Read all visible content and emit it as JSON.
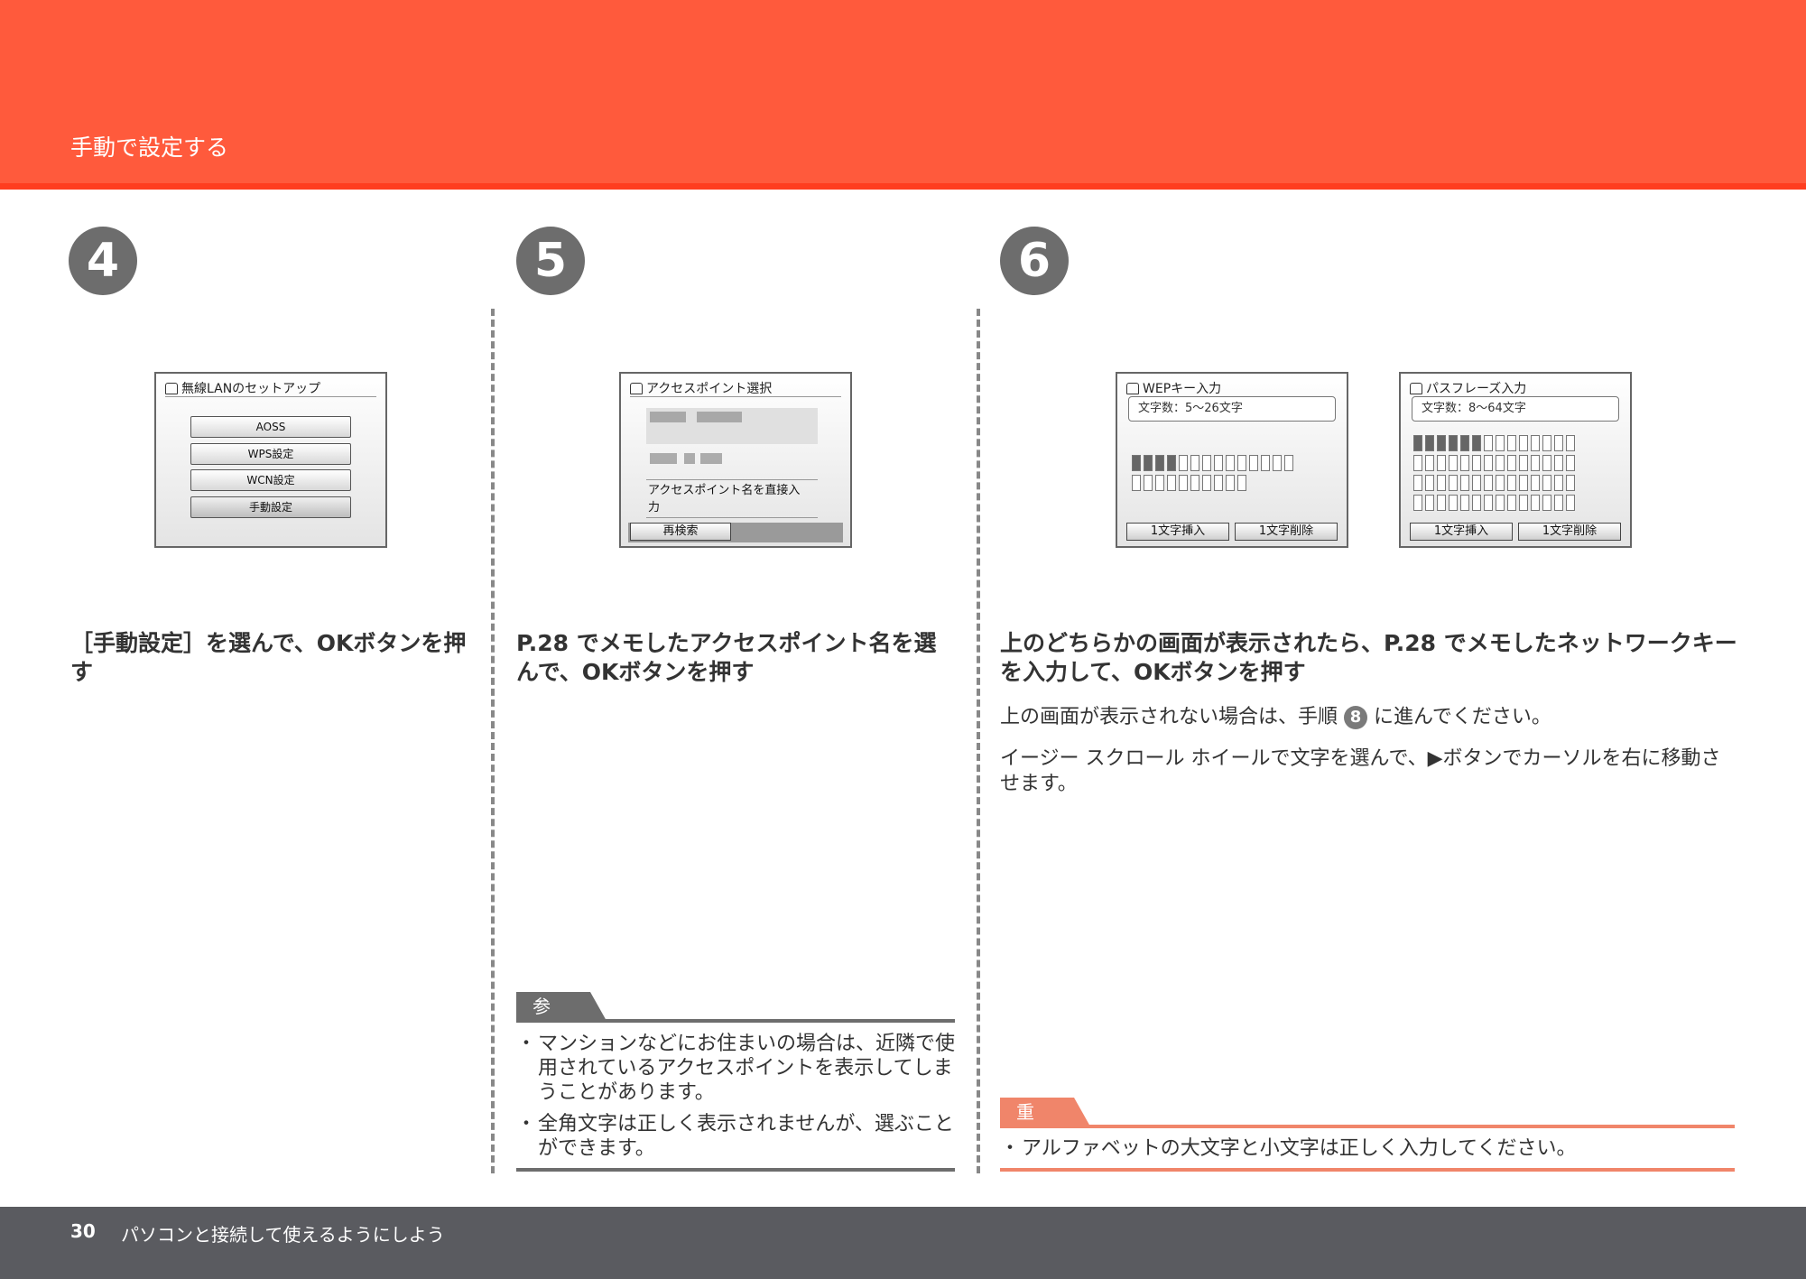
{
  "header": {
    "title": "手動で設定する"
  },
  "steps": [
    {
      "number": "4",
      "screen": {
        "title": "無線LANのセットアップ",
        "buttons": [
          "AOSS",
          "WPS設定",
          "WCN設定",
          "手動設定"
        ]
      },
      "heading": "［手動設定］を選んで、OKボタンを押す"
    },
    {
      "number": "5",
      "screen": {
        "title": "アクセスポイント選択",
        "manual_entry": "アクセスポイント名を直接入力",
        "research_button": "再検索"
      },
      "heading": "P.28 でメモしたアクセスポイント名を選んで、OKボタンを押す",
      "note": {
        "label": "参 考",
        "items": [
          "マンションなどにお住まいの場合は、近隣で使用されているアクセスポイントを表示してしまうことがあります。",
          "全角文字は正しく表示されませんが、選ぶことができます。"
        ]
      }
    },
    {
      "number": "6",
      "screens": [
        {
          "title": "WEPキー入力",
          "count": "文字数：5〜26文字",
          "insert": "1文字挿入",
          "delete": "1文字削除"
        },
        {
          "title": "パスフレーズ入力",
          "count": "文字数：8〜64文字",
          "insert": "1文字挿入",
          "delete": "1文字削除"
        }
      ],
      "heading": "上のどちらかの画面が表示されたら、P.28 でメモしたネットワークキーを入力して、OKボタンを押す",
      "text1_prefix": "上の画面が表示されない場合は、手順",
      "text1_step": "8",
      "text1_suffix": "に進んでください。",
      "text2": "イージー スクロール ホイールで文字を選んで、▶ボタンでカーソルを右に移動させます。",
      "important": {
        "label": "重 要",
        "items": [
          "アルファベットの大文字と小文字は正しく入力してください。"
        ]
      }
    }
  ],
  "footer": {
    "page": "30",
    "text": "パソコンと接続して使えるようにしよう"
  },
  "colors": {
    "header": "#ff5a3c",
    "footer": "#5a5b60",
    "important": "#f0856a",
    "note": "#6d6d6d"
  }
}
